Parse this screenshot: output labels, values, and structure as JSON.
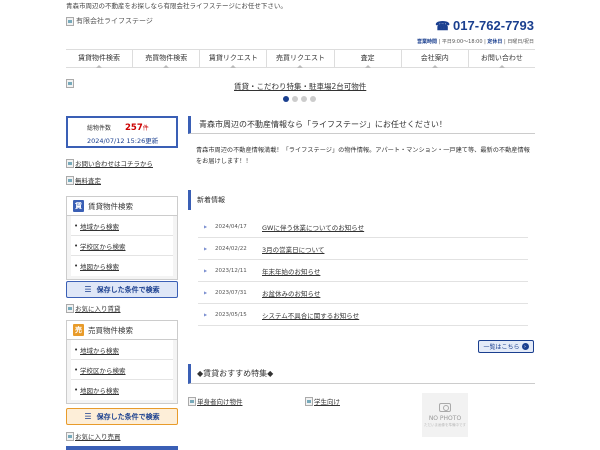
{
  "header": {
    "tagline": "青森市周辺の不動産をお探しなら有限会社ライフステージにお任せ下さい。",
    "logo_alt": "有限会社ライフステージ",
    "phone": "017-762-7793",
    "hours_label": "営業時間",
    "hours_value": "平日9:00～18:00",
    "holiday_label": "定休日",
    "holiday_value": "日曜日/祝日"
  },
  "nav": {
    "items": [
      "賃貸物件検索",
      "売買物件検索",
      "賃貸リクエスト",
      "売買リクエスト",
      "査定",
      "会社案内",
      "お問い合わせ"
    ]
  },
  "banner": {
    "link_text": "賃貸・こだわり特集・駐車場2台可物件",
    "slide_count": 4,
    "active_slide": 0
  },
  "stats": {
    "label": "総物件数",
    "count": "257",
    "unit": "件",
    "updated": "2024/07/12 15:26更新"
  },
  "sidebar": {
    "contact_link": "お問い合わせはコチラから",
    "assessment_link": "無料査定",
    "rent": {
      "title": "賃貸物件検索",
      "icon_char": "賃",
      "items": [
        "地域から検索",
        "学校区から検索",
        "地図から検索"
      ],
      "saved_label": "保存した条件で検索",
      "favorite_link": "お気に入り賃貸"
    },
    "sale": {
      "title": "売買物件検索",
      "icon_char": "売",
      "items": [
        "地域から検索",
        "学校区から検索",
        "地図から検索"
      ],
      "saved_label": "保存した条件で検索",
      "favorite_link": "お気に入り売買"
    }
  },
  "main": {
    "title": "青森市周辺の不動産情報なら「ライフステージ」にお任せください！",
    "intro": "青森市周辺の不動産情報満載！「ライフステージ」の物件情報。アパート・マンション・一戸建て等、最新の不動産情報をお届けします！！",
    "news_title": "新着情報",
    "news": [
      {
        "date": "2024/04/17",
        "title": "GWに伴う休業についてのお知らせ"
      },
      {
        "date": "2024/02/22",
        "title": "3月の営業日について"
      },
      {
        "date": "2023/12/11",
        "title": "年末年始のお知らせ"
      },
      {
        "date": "2023/07/31",
        "title": "お盆休みのお知らせ"
      },
      {
        "date": "2023/05/15",
        "title": "システム不具合に関するお知らせ"
      }
    ],
    "more_label": "一覧はこちら",
    "recommend_title": "◆賃貸おすすめ特集◆",
    "recommend": [
      {
        "label": "単身者向け物件"
      },
      {
        "label": "学生向け"
      }
    ],
    "nophoto_label": "NO PHOTO",
    "nophoto_sub": "ただいま画像を準備中です"
  },
  "colors": {
    "brand": "#1a3f8f",
    "accent_orange": "#e89b2a",
    "count_red": "#cc0000"
  }
}
